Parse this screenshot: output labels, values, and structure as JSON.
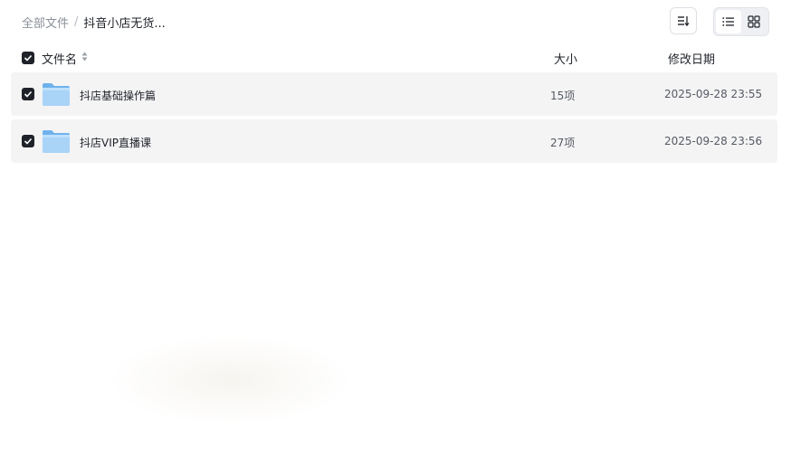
{
  "breadcrumb": {
    "root": "全部文件",
    "separator": "/",
    "current": "抖音小店无货..."
  },
  "toolbar": {
    "sort_icon": "sort-lines-icon",
    "view_list_icon": "list-view-icon",
    "view_grid_icon": "grid-view-icon",
    "active_view": "list"
  },
  "table": {
    "headers": {
      "name": "文件名",
      "size": "大小",
      "modified": "修改日期"
    },
    "rows": [
      {
        "name": "抖店基础操作篇",
        "size": "15项",
        "modified": "2025-09-28 23:55",
        "icon": "folder-icon",
        "checked": true
      },
      {
        "name": "抖店VIP直播课",
        "size": "27项",
        "modified": "2025-09-28 23:56",
        "icon": "folder-icon",
        "checked": true
      }
    ]
  },
  "colors": {
    "row_background": "#f4f4f5",
    "checkbox": "#1f2329",
    "folder_light": "#a9d3f7",
    "folder_dark": "#6fb2ec"
  }
}
